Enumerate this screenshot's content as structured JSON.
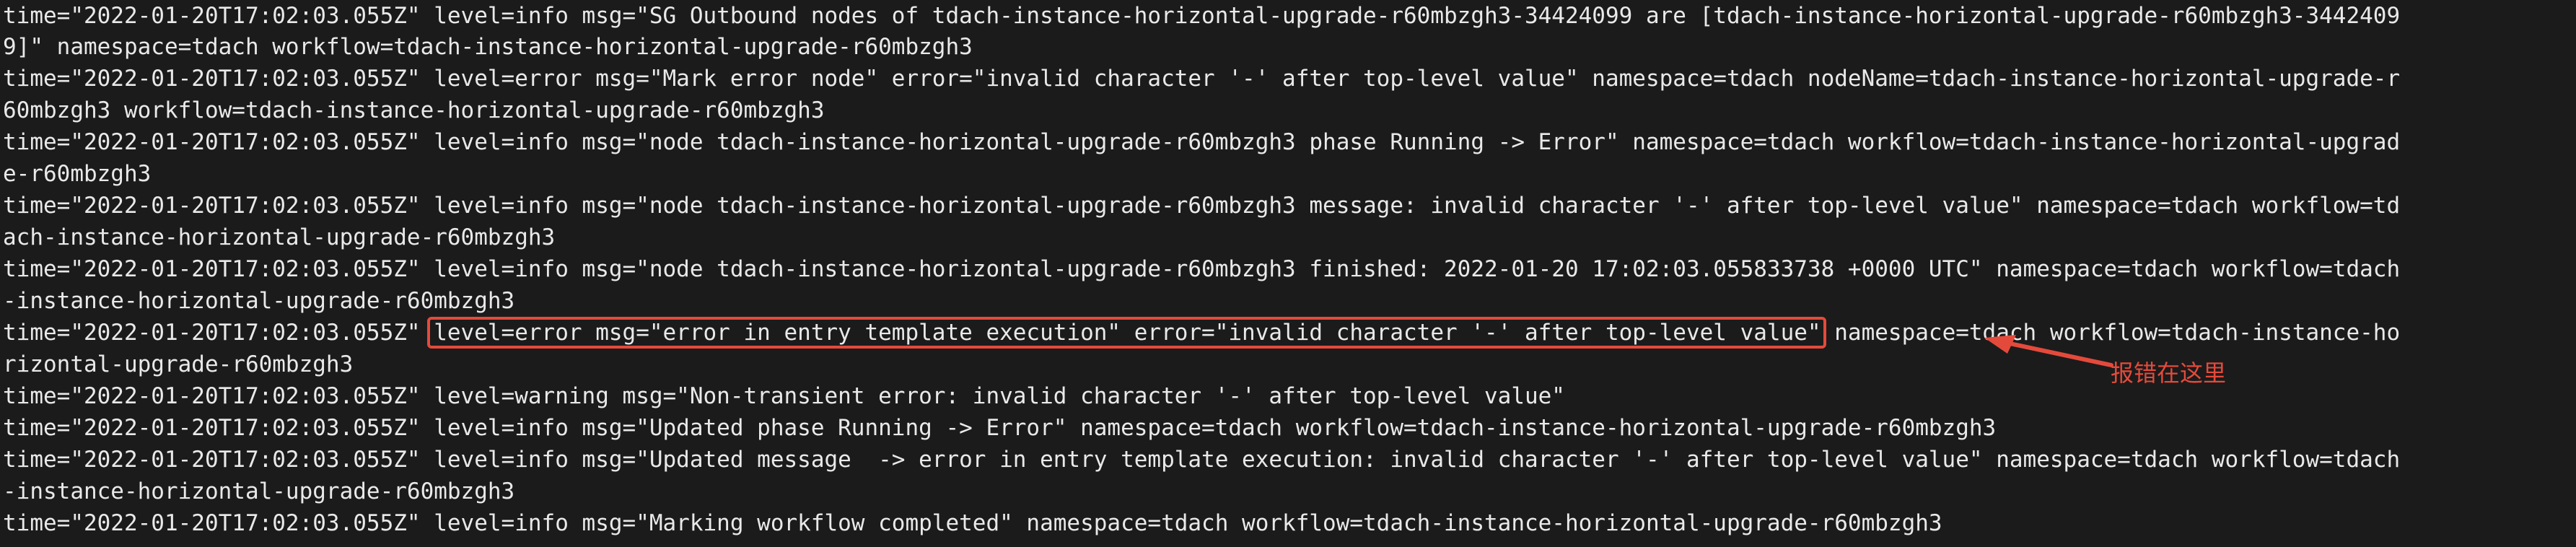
{
  "terminal": {
    "lines": [
      "time=\"2022-01-20T17:02:03.055Z\" level=info msg=\"SG Outbound nodes of tdach-instance-horizontal-upgrade-r60mbzgh3-34424099 are [tdach-instance-horizontal-upgrade-r60mbzgh3-3442409",
      "9]\" namespace=tdach workflow=tdach-instance-horizontal-upgrade-r60mbzgh3",
      "time=\"2022-01-20T17:02:03.055Z\" level=error msg=\"Mark error node\" error=\"invalid character '-' after top-level value\" namespace=tdach nodeName=tdach-instance-horizontal-upgrade-r",
      "60mbzgh3 workflow=tdach-instance-horizontal-upgrade-r60mbzgh3",
      "time=\"2022-01-20T17:02:03.055Z\" level=info msg=\"node tdach-instance-horizontal-upgrade-r60mbzgh3 phase Running -> Error\" namespace=tdach workflow=tdach-instance-horizontal-upgrad",
      "e-r60mbzgh3",
      "time=\"2022-01-20T17:02:03.055Z\" level=info msg=\"node tdach-instance-horizontal-upgrade-r60mbzgh3 message: invalid character '-' after top-level value\" namespace=tdach workflow=td",
      "ach-instance-horizontal-upgrade-r60mbzgh3",
      "time=\"2022-01-20T17:02:03.055Z\" level=info msg=\"node tdach-instance-horizontal-upgrade-r60mbzgh3 finished: 2022-01-20 17:02:03.055833738 +0000 UTC\" namespace=tdach workflow=tdach",
      "-instance-horizontal-upgrade-r60mbzgh3",
      "",
      "rizontal-upgrade-r60mbzgh3",
      "time=\"2022-01-20T17:02:03.055Z\" level=warning msg=\"Non-transient error: invalid character '-' after top-level value\"",
      "time=\"2022-01-20T17:02:03.055Z\" level=info msg=\"Updated phase Running -> Error\" namespace=tdach workflow=tdach-instance-horizontal-upgrade-r60mbzgh3",
      "time=\"2022-01-20T17:02:03.055Z\" level=info msg=\"Updated message  -> error in entry template execution: invalid character '-' after top-level value\" namespace=tdach workflow=tdach",
      "-instance-horizontal-upgrade-r60mbzgh3",
      "time=\"2022-01-20T17:02:03.055Z\" level=info msg=\"Marking workflow completed\" namespace=tdach workflow=tdach-instance-horizontal-upgrade-r60mbzgh3"
    ],
    "highlight_line": {
      "prefix": "time=\"2022-01-20T17:02:03.055Z\" ",
      "boxed": "level=error msg=\"error in entry template execution\" error=\"invalid character '-' after top-level value\"",
      "suffix": " namespace=tdach workflow=tdach-instance-ho"
    }
  },
  "annotation": {
    "label": "报错在这里",
    "color": "#e44a3b"
  }
}
